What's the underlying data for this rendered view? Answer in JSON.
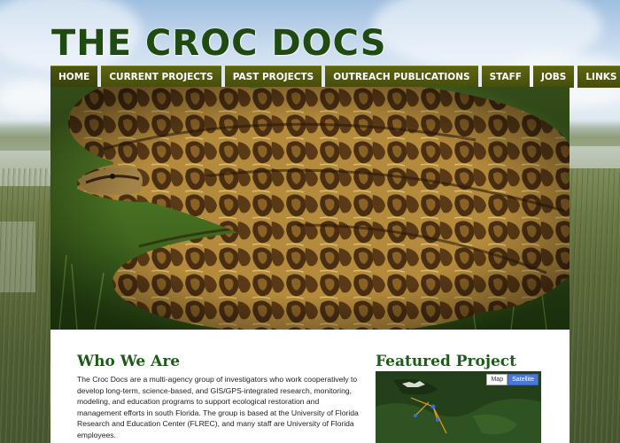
{
  "site": {
    "title": "THE CROC DOCS"
  },
  "nav": {
    "items": [
      {
        "label": "HOME",
        "active": true
      },
      {
        "label": "CURRENT PROJECTS"
      },
      {
        "label": "PAST PROJECTS"
      },
      {
        "label": "OUTREACH PUBLICATIONS"
      },
      {
        "label": "STAFF"
      },
      {
        "label": "JOBS"
      },
      {
        "label": "LINKS"
      }
    ]
  },
  "hero": {
    "image": "burmese-python-photo"
  },
  "who_we_are": {
    "heading": "Who We Are",
    "text": "The Croc Docs are a multi-agency group of investigators who work cooperatively to develop long-term, science-based, and GIS/GPS-integrated research, monitoring, modeling, and education programs to support ecological restoration and management efforts in south Florida. The group is based at the University of Florida Research and Education Center (FLREC), and many staff are University of Florida employees."
  },
  "featured": {
    "heading": "Featured Project",
    "map_type_buttons": [
      "Map",
      "Satellite"
    ],
    "selected_map_type": "Satellite"
  },
  "colors": {
    "title": "#1f4a12",
    "nav_bg": "#4f560f",
    "heading": "#1f5a1a"
  }
}
